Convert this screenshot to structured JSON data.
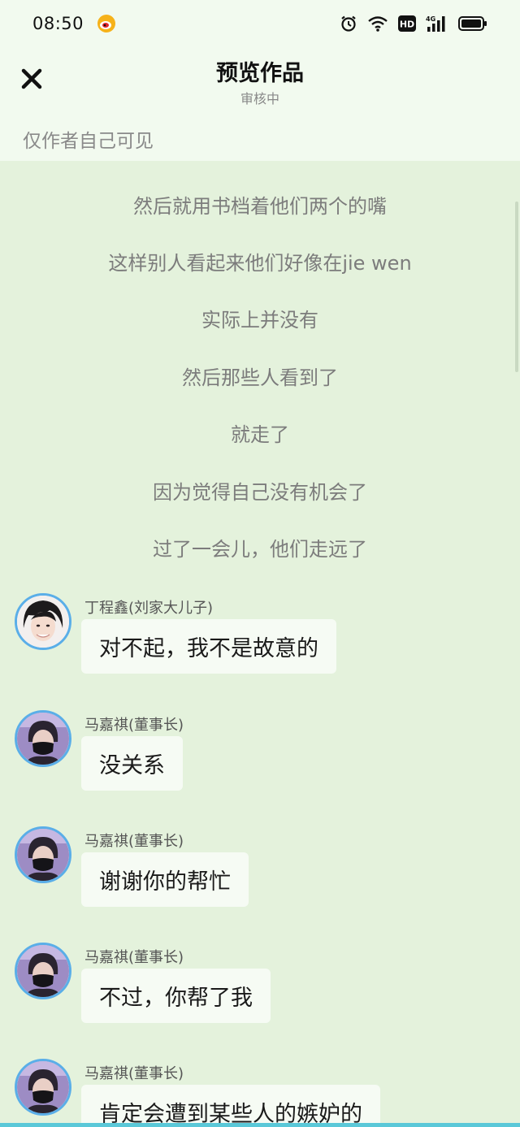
{
  "status_bar": {
    "time": "08:50",
    "icons": [
      "weibo-icon",
      "alarm-icon",
      "wifi-icon",
      "hd-icon",
      "4g-signal-icon",
      "battery-icon"
    ],
    "hd_label": "HD",
    "network_label": "4G"
  },
  "header": {
    "title": "预览作品",
    "subtitle": "审核中",
    "visibility_note": "仅作者自己可见"
  },
  "narration": [
    "然后就用书档着他们两个的嘴",
    "这样别人看起来他们好像在jie wen",
    "实际上并没有",
    "然后那些人看到了",
    "就走了",
    "因为觉得自己没有机会了",
    "过了一会儿，他们走远了"
  ],
  "messages": [
    {
      "sender": "丁程鑫(刘家大儿子)",
      "text": "对不起，我不是故意的"
    },
    {
      "sender": "马嘉祺(董事长)",
      "text": "没关系"
    },
    {
      "sender": "马嘉祺(董事长)",
      "text": "谢谢你的帮忙"
    },
    {
      "sender": "马嘉祺(董事长)",
      "text": "不过，你帮了我"
    },
    {
      "sender": "马嘉祺(董事长)",
      "text": "肯定会遭到某些人的嫉妒的"
    }
  ],
  "colors": {
    "background": "#e4f2dc",
    "header_background": "#f2faef",
    "bubble": "#f6fbf4",
    "avatar_ring": "#5aaee8",
    "narration_text": "#7c7c7c"
  }
}
